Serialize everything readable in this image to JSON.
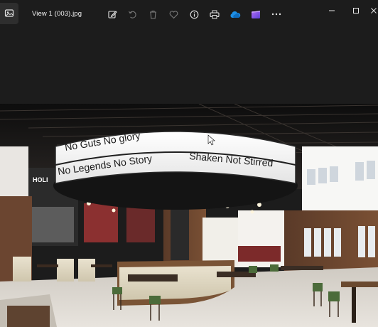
{
  "window": {
    "filename": "View 1 (003).jpg"
  },
  "toolbar": {
    "icons": [
      "edit-image-icon",
      "rotate-icon",
      "delete-icon",
      "favorite-icon",
      "info-icon",
      "print-icon",
      "onedrive-icon",
      "clipchamp-icon",
      "more-icon"
    ]
  },
  "window_controls": [
    "minimize-icon",
    "maximize-icon",
    "close-icon"
  ],
  "photo": {
    "sign_text_left_top": "No Guts No glory",
    "sign_text_left_bottom": "No Legends No Story",
    "sign_text_right": "Shaken Not Stirred",
    "wall_text": "HOLI"
  },
  "colors": {
    "background": "#1c1c1c",
    "onedrive": "#1e90e6",
    "clipchamp": "#8b5cf6"
  }
}
